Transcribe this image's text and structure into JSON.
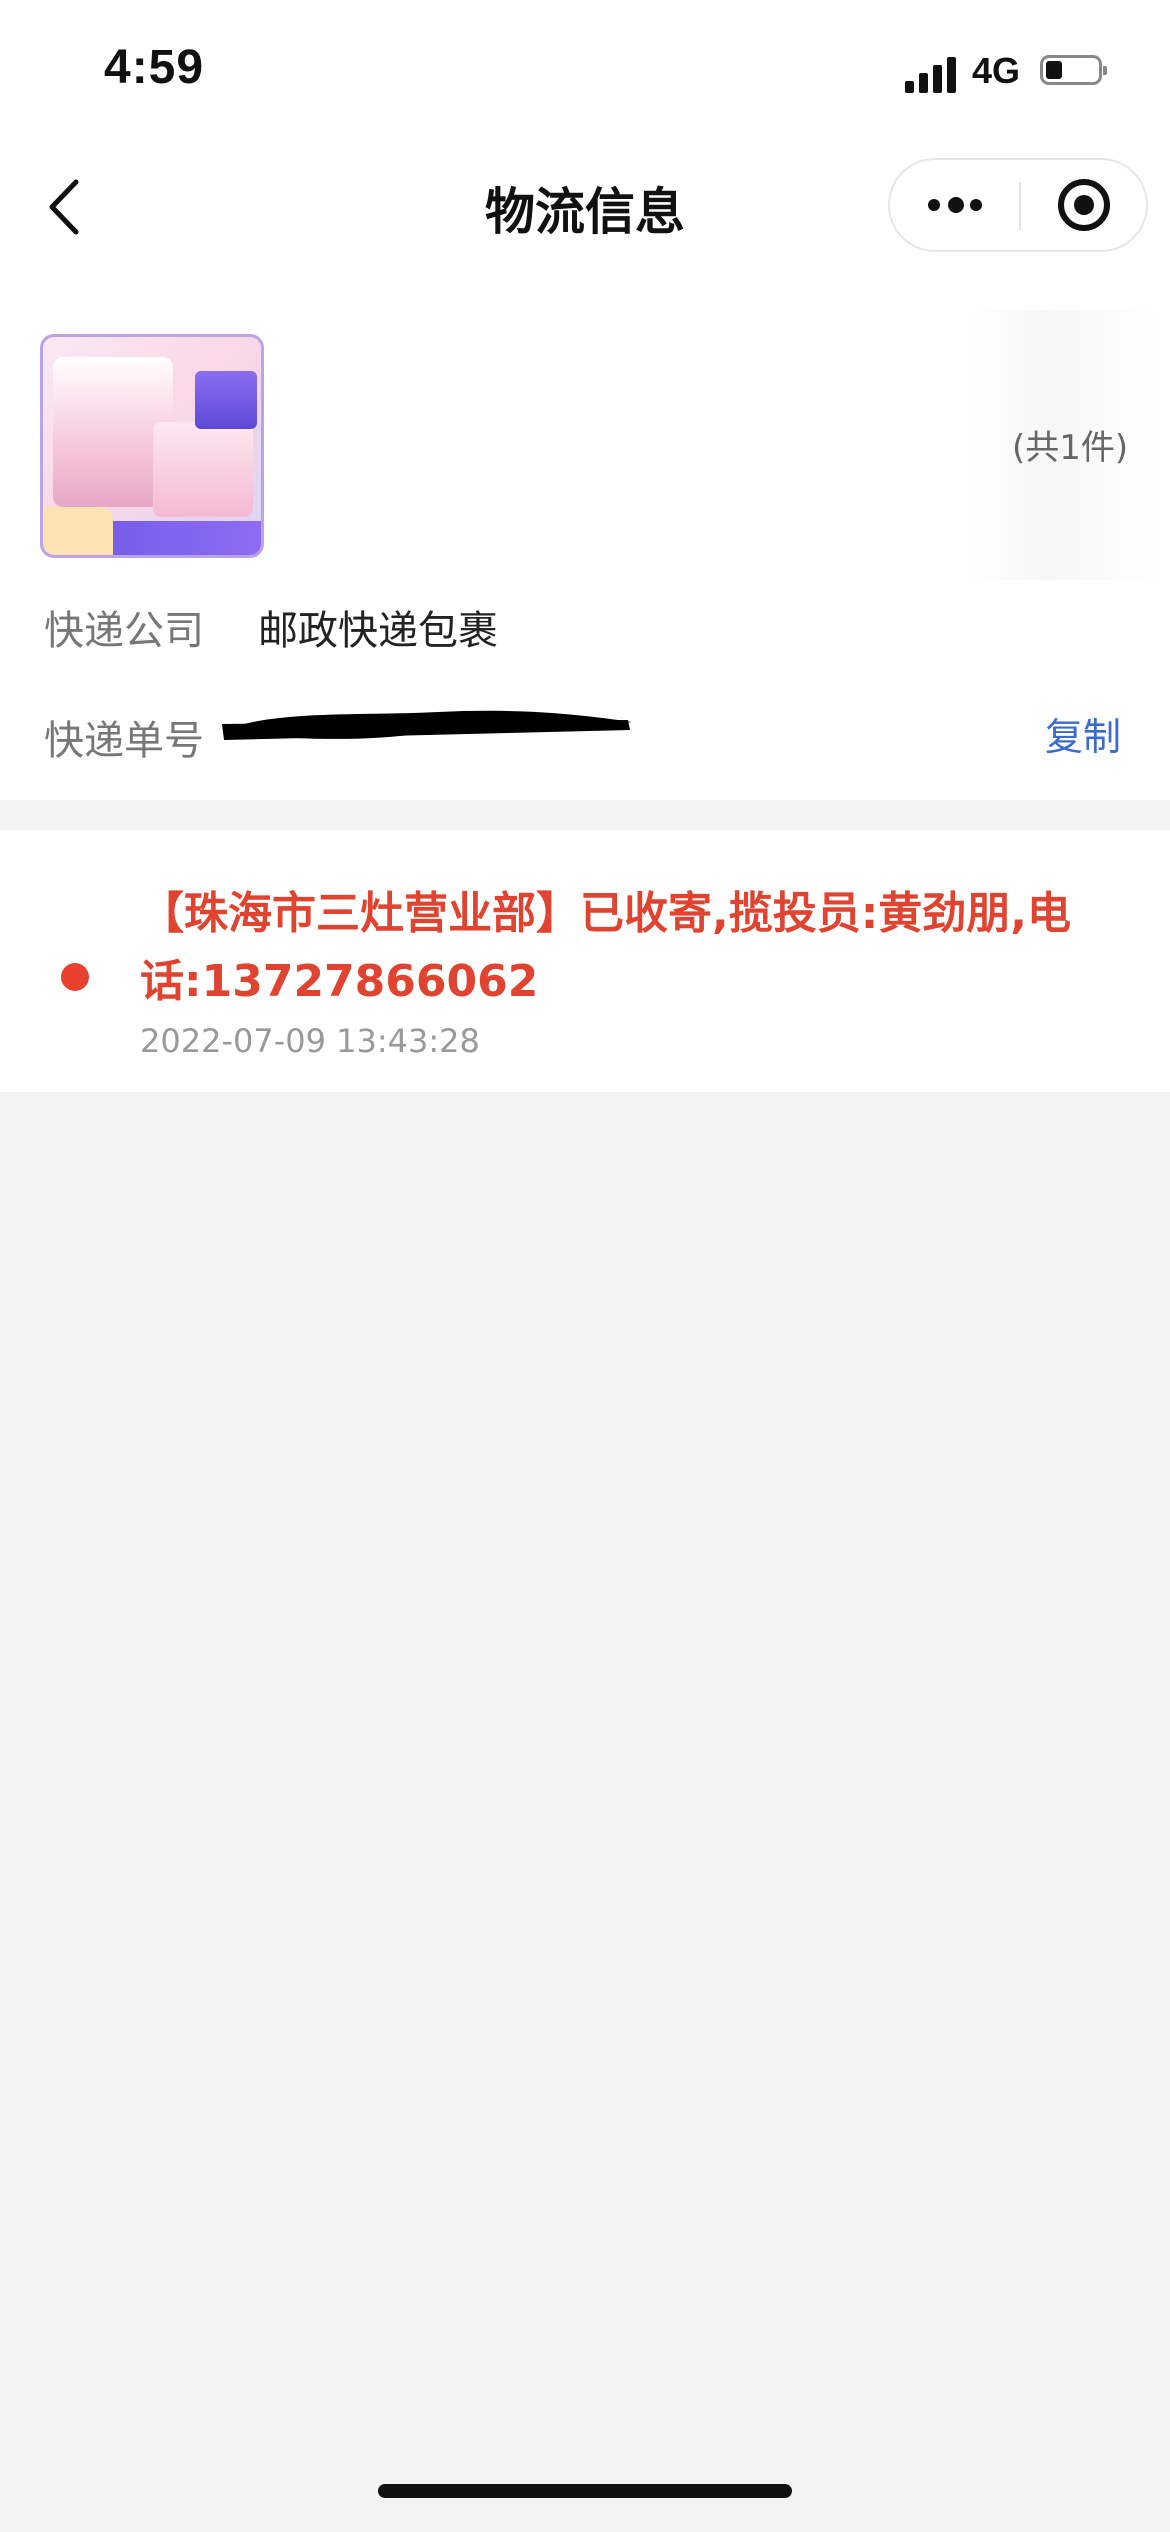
{
  "status_bar": {
    "time": "4:59",
    "network": "4G"
  },
  "nav": {
    "title": "物流信息"
  },
  "product": {
    "count_text": "(共1件)"
  },
  "shipping": {
    "company_label": "快递公司",
    "company_value": "邮政快递包裹",
    "tracking_label": "快递单号",
    "copy_label": "复制"
  },
  "tracking": {
    "events": [
      {
        "text": "【珠海市三灶营业部】已收寄,揽投员:黄劲朋,电话:13727866062",
        "time": "2022-07-09 13:43:28"
      }
    ]
  },
  "colors": {
    "accent_red": "#e8412f",
    "link_blue": "#3a6bd2"
  },
  "icons": [
    "back-chevron-icon",
    "more-dots-icon",
    "target-close-icon",
    "signal-icon",
    "battery-icon"
  ]
}
